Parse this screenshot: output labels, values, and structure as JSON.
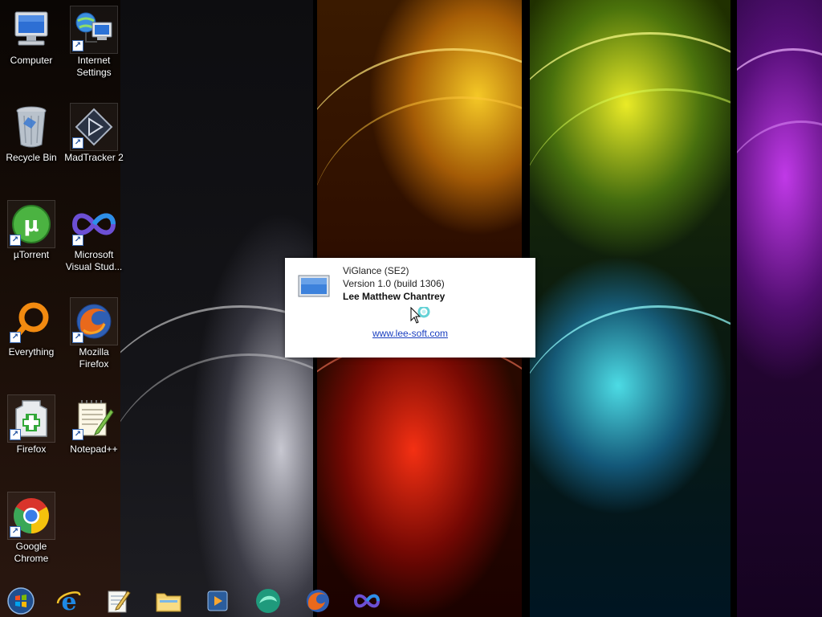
{
  "desktop": {
    "icons": [
      {
        "label": "Computer",
        "icon": "computer-icon"
      },
      {
        "label": "Internet Settings",
        "icon": "network-icon"
      },
      {
        "label": "Recycle Bin",
        "icon": "recycle-bin-icon"
      },
      {
        "label": "MadTracker 2",
        "icon": "madtracker-icon"
      },
      {
        "label": "µTorrent",
        "icon": "utorrent-icon"
      },
      {
        "label": "Microsoft Visual Stud...",
        "icon": "visual-studio-icon"
      },
      {
        "label": "Everything",
        "icon": "everything-search-icon"
      },
      {
        "label": "Mozilla Firefox",
        "icon": "firefox-icon"
      },
      {
        "label": "Firefox",
        "icon": "firefox-portable-icon"
      },
      {
        "label": "Notepad++",
        "icon": "notepad-plus-plus-icon"
      },
      {
        "label": "Google Chrome",
        "icon": "chrome-icon"
      }
    ]
  },
  "popup": {
    "app_name": "ViGlance (SE2)",
    "version": "Version 1.0 (build 1306)",
    "author": "Lee Matthew Chantrey",
    "website": "www.lee-soft.com"
  },
  "taskbar": {
    "items": [
      {
        "icon": "start-orb-icon"
      },
      {
        "icon": "internet-explorer-icon"
      },
      {
        "icon": "notepad-icon"
      },
      {
        "icon": "file-explorer-icon"
      },
      {
        "icon": "media-player-icon"
      },
      {
        "icon": "viglance-icon"
      },
      {
        "icon": "firefox-icon"
      },
      {
        "icon": "visual-studio-icon"
      }
    ]
  },
  "colors": {
    "link": "#1a3fc0",
    "popup_background": "#ffffff",
    "label_text": "#ffffff"
  }
}
